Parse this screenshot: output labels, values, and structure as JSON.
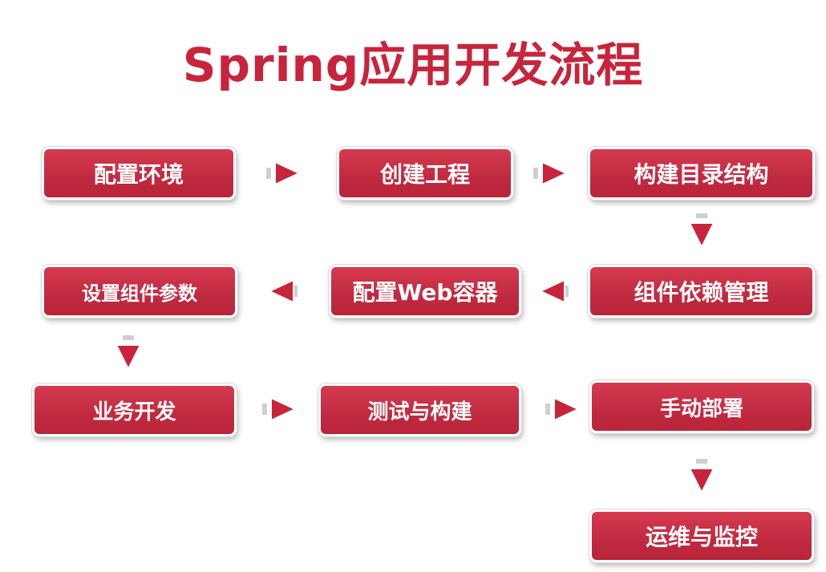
{
  "title": "Spring应用开发流程",
  "colors": {
    "accent": "#c8243c",
    "node_fill": "#c62d43",
    "arrow_fill": "#c8243c",
    "arrow_stub": "#cfcfcf"
  },
  "steps": [
    {
      "id": "s1",
      "label": "配置环境"
    },
    {
      "id": "s2",
      "label": "创建工程"
    },
    {
      "id": "s3",
      "label": "构建目录结构"
    },
    {
      "id": "s4",
      "label": "组件依赖管理"
    },
    {
      "id": "s5",
      "label": "配置Web容器"
    },
    {
      "id": "s6",
      "label": "设置组件参数"
    },
    {
      "id": "s7",
      "label": "业务开发"
    },
    {
      "id": "s8",
      "label": "测试与构建"
    },
    {
      "id": "s9",
      "label": "手动部署"
    },
    {
      "id": "s10",
      "label": "运维与监控"
    }
  ],
  "edges": [
    {
      "from": "s1",
      "to": "s2"
    },
    {
      "from": "s2",
      "to": "s3"
    },
    {
      "from": "s3",
      "to": "s4"
    },
    {
      "from": "s4",
      "to": "s5"
    },
    {
      "from": "s5",
      "to": "s6"
    },
    {
      "from": "s6",
      "to": "s7"
    },
    {
      "from": "s7",
      "to": "s8"
    },
    {
      "from": "s8",
      "to": "s9"
    },
    {
      "from": "s9",
      "to": "s10"
    }
  ]
}
